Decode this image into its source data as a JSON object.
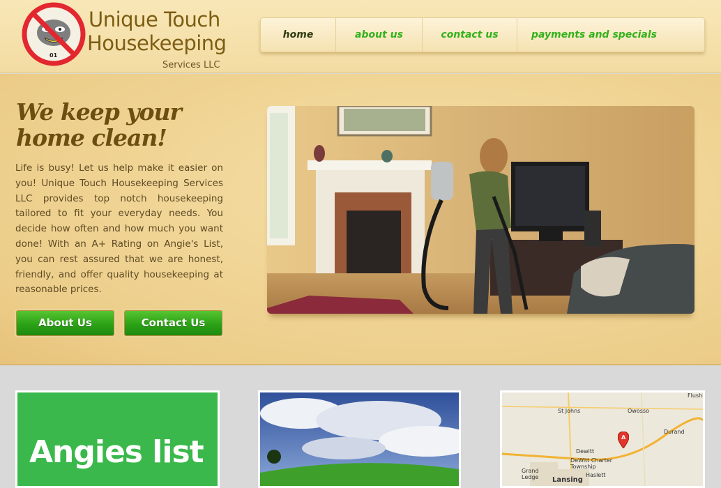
{
  "logo": {
    "line1": "Unique Touch",
    "line2": "Housekeeping",
    "line3": "Services LLC",
    "icon": "no-dust-bunny-logo"
  },
  "nav": {
    "items": [
      {
        "label": "home",
        "active": true
      },
      {
        "label": "about us",
        "active": false
      },
      {
        "label": "contact us",
        "active": false
      },
      {
        "label": "payments and specials",
        "active": false
      }
    ]
  },
  "hero": {
    "title": "We keep your home clean!",
    "body": "Life is busy! Let us help make it easier on you! Unique Touch Housekeeping Services LLC provides top notch housekeeping tailored to fit your everyday needs. You decide how often and how much you want done! With an A+ Rating on Angie's List, you can rest assured that we are honest, friendly, and offer quality housekeeping at reasonable prices.",
    "about_button": "About Us",
    "contact_button": "Contact Us"
  },
  "boxes": {
    "angies_label": "Angies list",
    "map_labels": {
      "st_johns": "St Johns",
      "owosso": "Owosso",
      "durand": "Durand",
      "dewitt": "Dewitt",
      "dewitt_twp": "DeWitt Charter Township",
      "grand_ledge": "Grand Ledge",
      "haslett": "Haslett",
      "lansing": "Lansing",
      "flushing": "Flushi",
      "marker": "A"
    }
  },
  "colors": {
    "nav_link": "#33b11c",
    "nav_active": "#2f3b12",
    "button_green": "#2ba216",
    "title_brown": "#6b4e12",
    "angies_green": "#3bb84b"
  }
}
